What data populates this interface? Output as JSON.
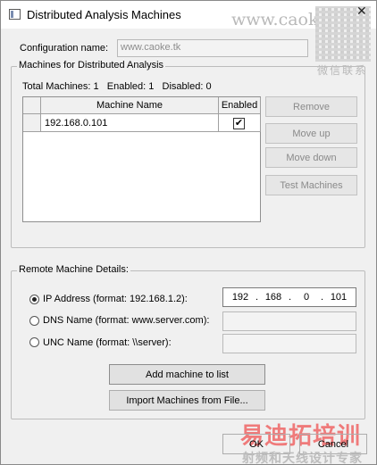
{
  "window": {
    "title": "Distributed Analysis Machines",
    "close_glyph": "✕"
  },
  "watermark": {
    "top_text": "www.caoke.tk",
    "qr_caption": "微信联系",
    "bottom_text": "易迪拓培训",
    "bottom_sub": "射频和天线设计专家"
  },
  "config": {
    "label": "Configuration name:",
    "value": "www.caoke.tk"
  },
  "machines_group": {
    "title": "Machines for Distributed Analysis",
    "summary": "Total Machines: 1   Enabled: 1   Disabled: 0",
    "columns": [
      "Machine Name",
      "Enabled"
    ],
    "rows": [
      {
        "name": "192.168.0.101",
        "enabled": true,
        "check_glyph": "✔"
      }
    ],
    "buttons": {
      "remove": "Remove",
      "move_up": "Move up",
      "move_down": "Move down",
      "test": "Test Machines"
    }
  },
  "remote": {
    "title": "Remote Machine Details:",
    "ip_label": "IP Address (format: 192.168.1.2):",
    "dns_label": "DNS Name (format: www.server.com):",
    "unc_label": "UNC Name (format: \\\\server):",
    "selected": "ip",
    "ip": [
      "192",
      "168",
      "0",
      "101"
    ],
    "ip_separator": "."
  },
  "actions": {
    "add": "Add machine to list",
    "import": "Import Machines from File..."
  },
  "footer": {
    "ok": "OK",
    "cancel": "Cancel"
  }
}
